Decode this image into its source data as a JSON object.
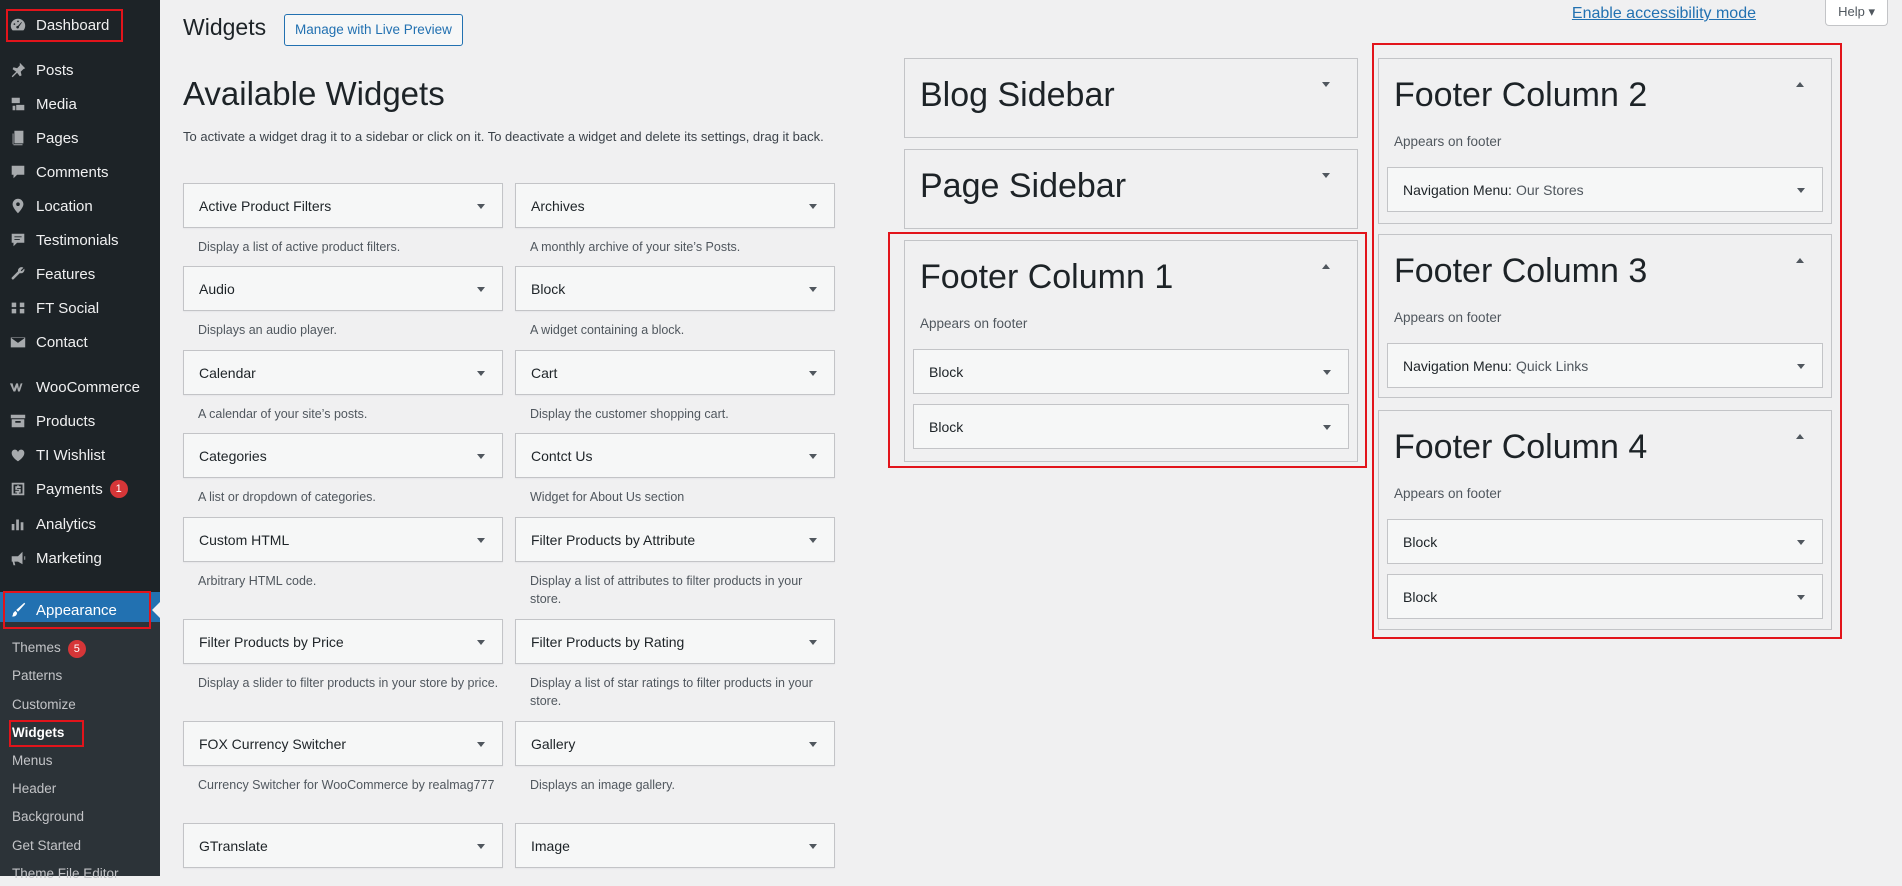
{
  "sidebar": {
    "menu": [
      {
        "label": "Dashboard",
        "icon": "dashboard-icon"
      },
      {
        "label": "Posts",
        "icon": "pin-icon"
      },
      {
        "label": "Media",
        "icon": "media-icon"
      },
      {
        "label": "Pages",
        "icon": "pages-icon"
      },
      {
        "label": "Comments",
        "icon": "comments-icon"
      },
      {
        "label": "Location",
        "icon": "location-icon"
      },
      {
        "label": "Testimonials",
        "icon": "testimonials-icon"
      },
      {
        "label": "Features",
        "icon": "wrench-icon"
      },
      {
        "label": "FT Social",
        "icon": "social-icon"
      },
      {
        "label": "Contact",
        "icon": "mail-icon"
      },
      {
        "label": "WooCommerce",
        "icon": "woo-icon"
      },
      {
        "label": "Products",
        "icon": "archive-icon"
      },
      {
        "label": "TI Wishlist",
        "icon": "heart-icon"
      },
      {
        "label": "Payments",
        "icon": "payments-icon",
        "badge": "1"
      },
      {
        "label": "Analytics",
        "icon": "analytics-icon"
      },
      {
        "label": "Marketing",
        "icon": "megaphone-icon"
      },
      {
        "label": "Appearance",
        "icon": "brush-icon"
      }
    ],
    "submenu": [
      {
        "label": "Themes",
        "badge": "5"
      },
      {
        "label": "Patterns"
      },
      {
        "label": "Customize"
      },
      {
        "label": "Widgets"
      },
      {
        "label": "Menus"
      },
      {
        "label": "Header"
      },
      {
        "label": "Background"
      },
      {
        "label": "Get Started"
      },
      {
        "label": "Theme File Editor"
      }
    ]
  },
  "header": {
    "title": "Widgets",
    "live_preview": "Manage with Live Preview",
    "accessibility": "Enable accessibility mode",
    "help": "Help ▾"
  },
  "available": {
    "title": "Available Widgets",
    "description": "To activate a widget drag it to a sidebar or click on it. To deactivate a widget and delete its settings, drag it back.",
    "widgets": [
      {
        "name": "Active Product Filters",
        "desc": "Display a list of active product filters."
      },
      {
        "name": "Archives",
        "desc": "A monthly archive of your site’s Posts."
      },
      {
        "name": "Audio",
        "desc": "Displays an audio player."
      },
      {
        "name": "Block",
        "desc": "A widget containing a block."
      },
      {
        "name": "Calendar",
        "desc": "A calendar of your site’s posts."
      },
      {
        "name": "Cart",
        "desc": "Display the customer shopping cart."
      },
      {
        "name": "Categories",
        "desc": "A list or dropdown of categories."
      },
      {
        "name": "Contct Us",
        "desc": "Widget for About Us section"
      },
      {
        "name": "Custom HTML",
        "desc": "Arbitrary HTML code."
      },
      {
        "name": "Filter Products by Attribute",
        "desc": "Display a list of attributes to filter products in your store."
      },
      {
        "name": "Filter Products by Price",
        "desc": "Display a slider to filter products in your store by price."
      },
      {
        "name": "Filter Products by Rating",
        "desc": "Display a list of star ratings to filter products in your store."
      },
      {
        "name": "FOX Currency Switcher",
        "desc": "Currency Switcher for WooCommerce by realmag777"
      },
      {
        "name": "Gallery",
        "desc": "Displays an image gallery."
      },
      {
        "name": "GTranslate",
        "desc": ""
      },
      {
        "name": "Image",
        "desc": ""
      }
    ]
  },
  "sidebars": {
    "blog": {
      "title": "Blog Sidebar"
    },
    "page": {
      "title": "Page Sidebar"
    },
    "footer1": {
      "title": "Footer Column 1",
      "desc": "Appears on footer",
      "widgets": [
        "Block",
        "Block"
      ]
    },
    "footer2": {
      "title": "Footer Column 2",
      "desc": "Appears on footer",
      "widget_label": "Navigation Menu:",
      "widget_sub": "Our Stores"
    },
    "footer3": {
      "title": "Footer Column 3",
      "desc": "Appears on footer",
      "widget_label": "Navigation Menu:",
      "widget_sub": "Quick Links"
    },
    "footer4": {
      "title": "Footer Column 4",
      "desc": "Appears on footer",
      "widgets": [
        "Block",
        "Block"
      ]
    }
  },
  "colors": {
    "admin_bar": "#1d2327",
    "accent": "#2271b1",
    "highlight": "#e2141b"
  }
}
